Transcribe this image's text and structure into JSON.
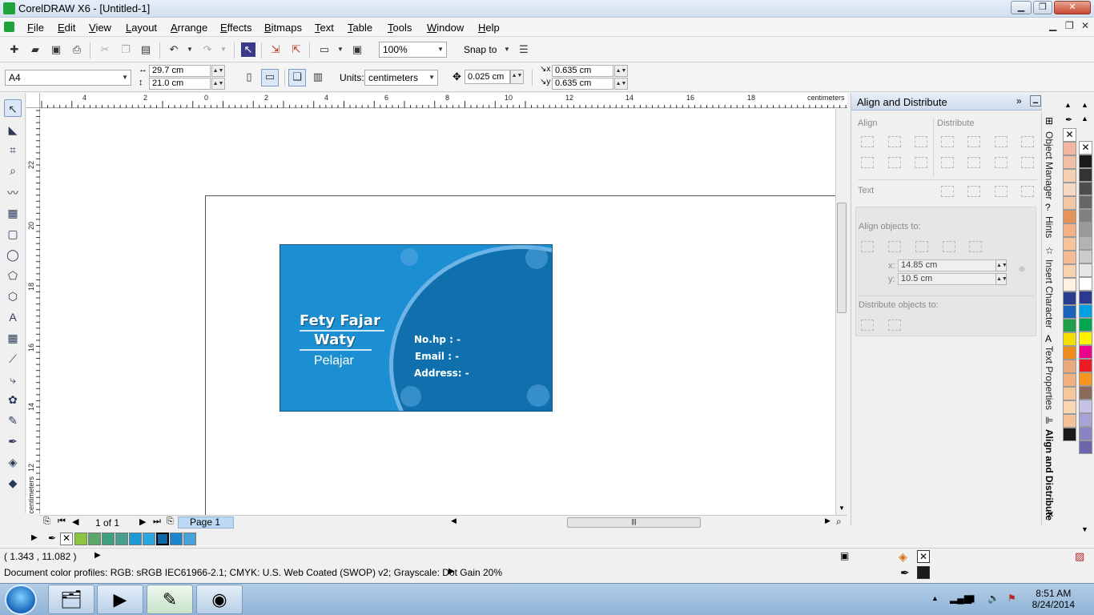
{
  "window": {
    "title": "CorelDRAW X6 - [Untitled-1]"
  },
  "menu": [
    "File",
    "Edit",
    "View",
    "Layout",
    "Arrange",
    "Effects",
    "Bitmaps",
    "Text",
    "Table",
    "Tools",
    "Window",
    "Help"
  ],
  "toolbar": {
    "zoom": "100%",
    "snap_to": "Snap to"
  },
  "propbar": {
    "page_size": "A4",
    "width": "29.7 cm",
    "height": "21.0 cm",
    "units_label": "Units:",
    "units": "centimeters",
    "nudge": "0.025 cm",
    "dup_x": "0.635 cm",
    "dup_y": "0.635 cm"
  },
  "ruler": {
    "h_ticks": [
      "4",
      "2",
      "0",
      "2",
      "4",
      "6",
      "8",
      "10",
      "12",
      "14",
      "16",
      "18"
    ],
    "h_unit": "centimeters",
    "v_ticks": [
      "22",
      "20",
      "18",
      "16",
      "14",
      "12"
    ],
    "v_unit": "centimeters"
  },
  "card": {
    "name_line1": "Fety Fajar",
    "name_line2": "Waty",
    "role": "Pelajar",
    "phone": "No.hp : -",
    "email": "Email : -",
    "address": "Address: -",
    "color_main": "#1c8fd3",
    "color_dark": "#0f70ad"
  },
  "pagenav": {
    "counter": "1 of 1",
    "tab": "Page 1"
  },
  "doc_palette": [
    "#8cc63f",
    "#5aa869",
    "#3f9f7f",
    "#4aa08f",
    "#1e9bd7",
    "#2aa7e0",
    "#0a6aa8",
    "#1b86cf",
    "#4aa2da"
  ],
  "docker": {
    "title": "Align and Distribute",
    "align": "Align",
    "distribute": "Distribute",
    "text": "Text",
    "align_to": "Align objects to:",
    "x_label": "x:",
    "x_value": "14.85 cm",
    "y_label": "y:",
    "y_value": "10.5 cm",
    "distribute_to": "Distribute objects to:"
  },
  "docker_tabs": [
    "Object Manager",
    "Hints",
    "Insert Character",
    "Text Properties",
    "Align and Distribute"
  ],
  "palette": {
    "col1": [
      "#f2b5a2",
      "#f0c0a8",
      "#f5cfb4",
      "#f7d9c3",
      "#f3c6a5",
      "#e6935a",
      "#f2b186",
      "#f5c49d",
      "#f4bc92",
      "#f8d2ae",
      "#fff0e0",
      "#2b3d8e",
      "#1a63b8",
      "#20a04a",
      "#f4e000",
      "#f08c1e",
      "#e8a97c",
      "#f0b07f",
      "#f6c79c",
      "#f9d7b3",
      "#f3c29a",
      "#1a1a1a"
    ],
    "col2": [
      "#1a1a1a",
      "#333333",
      "#4d4d4d",
      "#666666",
      "#808080",
      "#999999",
      "#b3b3b3",
      "#cccccc",
      "#e6e6e6",
      "#ffffff",
      "#2b3990",
      "#00a0e3",
      "#00a650",
      "#fff200",
      "#ec008c",
      "#ed1c24",
      "#f7941d",
      "#8b6a5a",
      "#c6c3e6",
      "#a6a3d6",
      "#8785c2",
      "#6a67ad"
    ]
  },
  "status": {
    "coords": "( 1.343 , 11.082 )",
    "profiles": "Document color profiles: RGB: sRGB IEC61966-2.1; CMYK: U.S. Web Coated (SWOP) v2; Grayscale: Dot Gain 20%"
  },
  "taskbar": {
    "time": "8:51 AM",
    "date": "8/24/2014"
  }
}
